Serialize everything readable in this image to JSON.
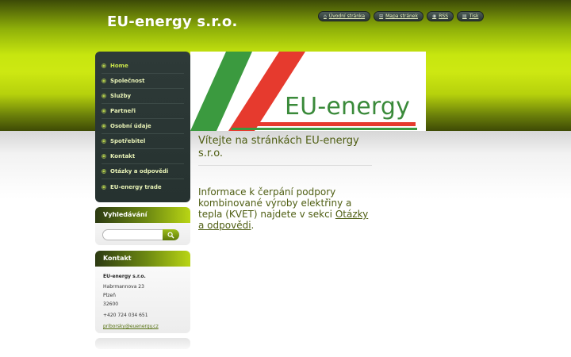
{
  "header": {
    "site_title": "EU-energy s.r.o.",
    "top_links": [
      {
        "label": "Úvodní stránka",
        "icon": "home-icon"
      },
      {
        "label": "Mapa stránek",
        "icon": "sitemap-icon"
      },
      {
        "label": "RSS",
        "icon": "rss-icon"
      },
      {
        "label": "Tisk",
        "icon": "print-icon"
      }
    ]
  },
  "nav": {
    "items": [
      {
        "label": "Home",
        "active": true
      },
      {
        "label": "Společnost"
      },
      {
        "label": "Služby"
      },
      {
        "label": "Partneři"
      },
      {
        "label": "Osobní údaje"
      },
      {
        "label": "Spotřebitel"
      },
      {
        "label": "Kontakt"
      },
      {
        "label": "Otázky a odpovědi"
      },
      {
        "label": "EU-energy trade"
      }
    ]
  },
  "search": {
    "title": "Vyhledávání",
    "placeholder": ""
  },
  "contact": {
    "title": "Kontakt",
    "company": "EU-energy s.r.o.",
    "street": "Habrmannova 23",
    "city": "Plzeň",
    "zip": "32600",
    "phone": "+420 724 034 651",
    "email": "priborsky@euenergy.cz"
  },
  "banner": {
    "logo_text": "EU-energy",
    "colors": {
      "green": "#3b9a3f",
      "red": "#e63a2e"
    }
  },
  "content": {
    "welcome": "Vítejte na stránkách EU-energy s.r.o.",
    "info_text": "Informace k čerpání podpory kombinované výroby elektřiny a tepla (KVET) najdete v sekci ",
    "info_link": "Otázky a odpovědi",
    "info_end": "."
  },
  "colors": {
    "accent": "#c7e60f",
    "nav_bg": "#2e3a38",
    "content_text": "#4f5e13"
  }
}
